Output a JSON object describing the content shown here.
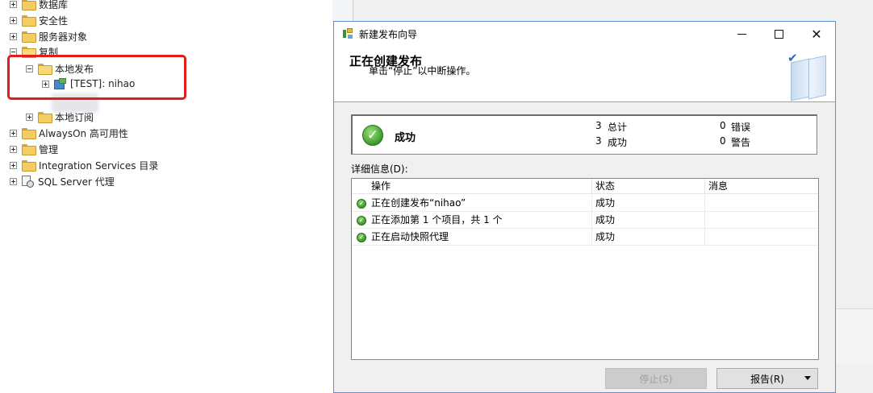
{
  "tree": {
    "items": [
      {
        "label": "数据库"
      },
      {
        "label": "安全性"
      },
      {
        "label": "服务器对象"
      },
      {
        "label": "复制"
      },
      {
        "label": "本地发布"
      },
      {
        "label": "[TEST]: nihao"
      },
      {
        "label": "本地订阅"
      },
      {
        "label": "AlwaysOn 高可用性"
      },
      {
        "label": "管理"
      },
      {
        "label": "Integration Services 目录"
      },
      {
        "label": "SQL Server 代理"
      }
    ]
  },
  "dialog": {
    "title": "新建发布向导",
    "heading": "正在创建发布",
    "subheading": "单击“停止”以中断操作。",
    "summary": {
      "status": "成功",
      "total_count": "3",
      "total_label": "总计",
      "success_count": "3",
      "success_label": "成功",
      "error_count": "0",
      "error_label": "错误",
      "warning_count": "0",
      "warning_label": "警告"
    },
    "details_label": "详细信息(D):",
    "columns": [
      "操作",
      "状态",
      "消息"
    ],
    "rows": [
      {
        "action": "正在创建发布“nihao”",
        "status": "成功",
        "message": ""
      },
      {
        "action": "正在添加第 1 个项目，共 1 个",
        "status": "成功",
        "message": ""
      },
      {
        "action": "正在启动快照代理",
        "status": "成功",
        "message": ""
      }
    ],
    "buttons": {
      "stop": "停止(S)",
      "report": "报告(R)"
    },
    "controls": {
      "close": "✕"
    }
  },
  "colors": {
    "highlight_box": "#e21b1b",
    "success_green": "#3c9b2a",
    "dialog_border": "#5b8fd6"
  }
}
